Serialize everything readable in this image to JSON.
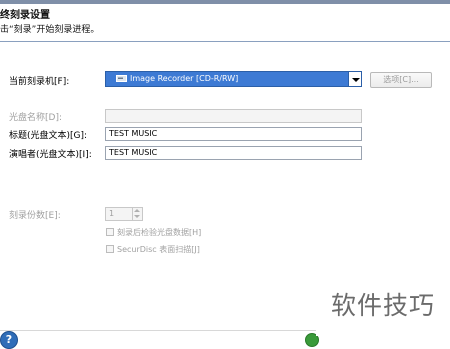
{
  "header": {
    "title": "终刻录设置",
    "subtitle": "击“刻录”开始刻录进程。"
  },
  "burner": {
    "label": "当前刻录机[F]:",
    "selected": "Image Recorder   [CD-R/RW]",
    "options_button": "选项[C]..."
  },
  "disc_name": {
    "label": "光盘名称[D]:",
    "value": ""
  },
  "title_field": {
    "label": "标题(光盘文本)[G]:",
    "value": "TEST MUSIC"
  },
  "artist_field": {
    "label": "演唱者(光盘文本)[I]:",
    "value": "TEST MUSIC"
  },
  "copies": {
    "label": "刻录份数[E]:",
    "value": "1"
  },
  "verify_checkbox": {
    "label": "刻录后检验光盘数据[H]"
  },
  "securdisc_checkbox": {
    "label": "SecurDisc 表面扫描[J]"
  },
  "footer": {
    "help_label": "?"
  },
  "watermark": {
    "text": "软件技巧"
  },
  "icons": [
    "drive-icon",
    "chevron-down-icon",
    "help-icon"
  ],
  "colors": {
    "selection": "#3d7ad4",
    "disabled_text": "#a0a0a0"
  }
}
